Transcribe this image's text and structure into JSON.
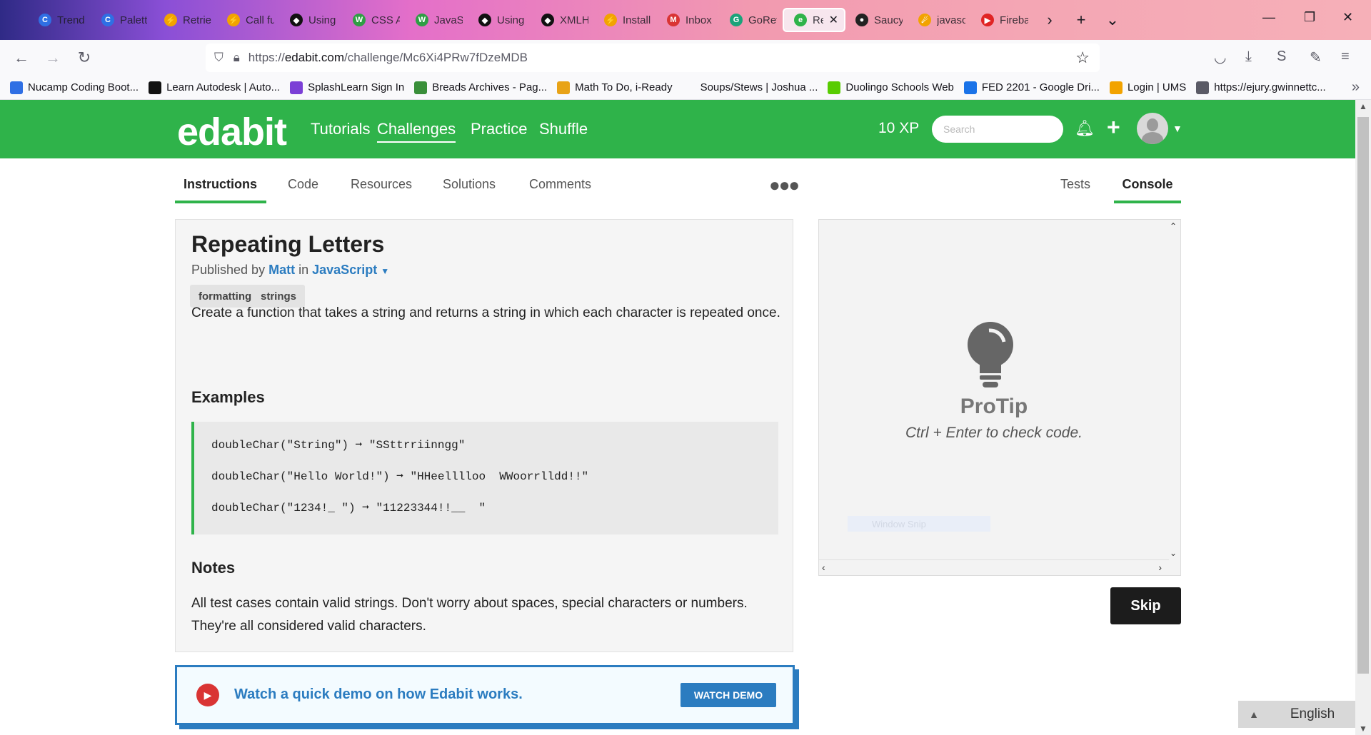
{
  "browser": {
    "tabs": [
      {
        "label": "Trend",
        "color": "#2f6fe4",
        "glyph": "C"
      },
      {
        "label": "Palett",
        "color": "#2f6fe4",
        "glyph": "C"
      },
      {
        "label": "Retrie",
        "color": "#f2a300",
        "glyph": "⚡"
      },
      {
        "label": "Call fu",
        "color": "#f2a300",
        "glyph": "⚡"
      },
      {
        "label": "Using",
        "color": "#111111",
        "glyph": "◆"
      },
      {
        "label": "CSS A",
        "color": "#2f9e44",
        "glyph": "W"
      },
      {
        "label": "JavaSc",
        "color": "#2f9e44",
        "glyph": "W"
      },
      {
        "label": "Using",
        "color": "#111111",
        "glyph": "◆"
      },
      {
        "label": "XMLH",
        "color": "#111111",
        "glyph": "◆"
      },
      {
        "label": "Install",
        "color": "#f2a300",
        "glyph": "⚡"
      },
      {
        "label": "Inbox",
        "color": "#d93434",
        "glyph": "M"
      },
      {
        "label": "GoRet",
        "color": "#1aa37a",
        "glyph": "G"
      },
      {
        "label": "Rep",
        "color": "#2fb34a",
        "glyph": "e",
        "active": true
      },
      {
        "label": "Saucy",
        "color": "#222222",
        "glyph": "●"
      },
      {
        "label": "javasc",
        "color": "#f2a300",
        "glyph": "☄"
      },
      {
        "label": "Fireba",
        "color": "#e02424",
        "glyph": "▶"
      }
    ],
    "url_prefix": "https://",
    "url_host": "edabit.com",
    "url_path": "/challenge/Mc6Xi4PRw7fDzeMDB",
    "bookmarks": [
      {
        "label": "Nucamp Coding Boot...",
        "color": "#2f6fe4"
      },
      {
        "label": "Learn Autodesk | Auto...",
        "color": "#111111"
      },
      {
        "label": "SplashLearn Sign In",
        "color": "#7b3fd6"
      },
      {
        "label": "Breads Archives - Pag...",
        "color": "#3a8f3a"
      },
      {
        "label": "Math To Do, i-Ready",
        "color": "#e8a317"
      },
      {
        "label": "Soups/Stews | Joshua ...",
        "color": "#f9f9fb"
      },
      {
        "label": "Duolingo Schools Web",
        "color": "#58cc02"
      },
      {
        "label": "FED 2201 - Google Dri...",
        "color": "#1a73e8"
      },
      {
        "label": "Login | UMS",
        "color": "#f2a300"
      },
      {
        "label": "https://ejury.gwinnettc...",
        "color": "#5b5b66"
      }
    ]
  },
  "site": {
    "logo": "edabit",
    "nav": [
      "Tutorials",
      "Challenges",
      "Practice",
      "Shuffle"
    ],
    "xp": "10 XP",
    "search_placeholder": "Search"
  },
  "subtabs": {
    "left": [
      "Instructions",
      "Code",
      "Resources",
      "Solutions",
      "Comments"
    ],
    "right": [
      "Tests",
      "Console"
    ]
  },
  "challenge": {
    "title": "Repeating Letters",
    "published_by": "Published by",
    "author": "Matt",
    "in": "in",
    "language": "JavaScript",
    "tags": [
      "formatting",
      "strings"
    ],
    "description": "Create a function that takes a string and returns a string in which each character is repeated once.",
    "examples_heading": "Examples",
    "examples": [
      "doubleChar(\"String\") ➞ \"SSttrriinngg\"",
      "doubleChar(\"Hello World!\") ➞ \"HHeelllloo  WWoorrlldd!!\"",
      "doubleChar(\"1234!_ \") ➞ \"11223344!!__  \""
    ],
    "notes_heading": "Notes",
    "notes": "All test cases contain valid strings. Don't worry about spaces, special characters or numbers. They're all considered valid characters."
  },
  "demo": {
    "text": "Watch a quick demo on how Edabit works.",
    "button": "WATCH DEMO"
  },
  "console": {
    "protip_title": "ProTip",
    "protip_text": "Ctrl + Enter to check code.",
    "faint_text": "Window Snip"
  },
  "skip_label": "Skip",
  "language_label": "English"
}
